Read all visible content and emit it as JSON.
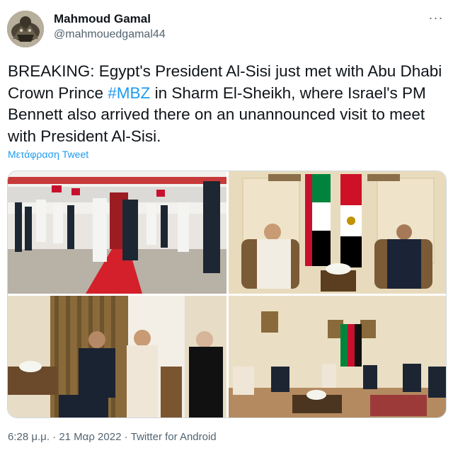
{
  "user": {
    "name": "Mahmoud Gamal",
    "handle": "@mahmouedgamal44"
  },
  "more_label": "···",
  "tweet": {
    "text_before": "BREAKING: Egypt's President Al-Sisi just met with Abu Dhabi Crown Prince ",
    "hashtag": "#MBZ",
    "text_after": " in Sharm El-Sheikh, where Israel's PM Bennett also arrived there on an unannounced visit to meet with President Al-Sisi."
  },
  "translate_label": "Μετάφραση Tweet",
  "meta": {
    "time": "6:28 μ.μ.",
    "separator": " · ",
    "date": "21 Μαρ 2022",
    "source": "Twitter for Android"
  },
  "colors": {
    "link": "#1d9bf0",
    "secondary_text": "#536471",
    "primary_text": "#0f1419"
  }
}
